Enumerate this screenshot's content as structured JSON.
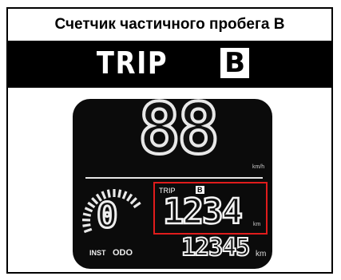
{
  "header": {
    "title": "Счетчик частичного пробега B",
    "banner_trip": "TRIP",
    "banner_letter": "B"
  },
  "display": {
    "speed_digits": "88",
    "speed_unit": "km/h",
    "gear": "0",
    "trip_label": "TRIP",
    "trip_letter": "B",
    "trip_value": "1234",
    "trip_unit": "km",
    "odo_value": "12345",
    "odo_unit": "km",
    "inst_label": "INST",
    "odo_label": "ODO"
  },
  "colors": {
    "highlight_border": "#e01c1c",
    "display_background": "#0b0b0b",
    "banner_background": "#000000"
  }
}
